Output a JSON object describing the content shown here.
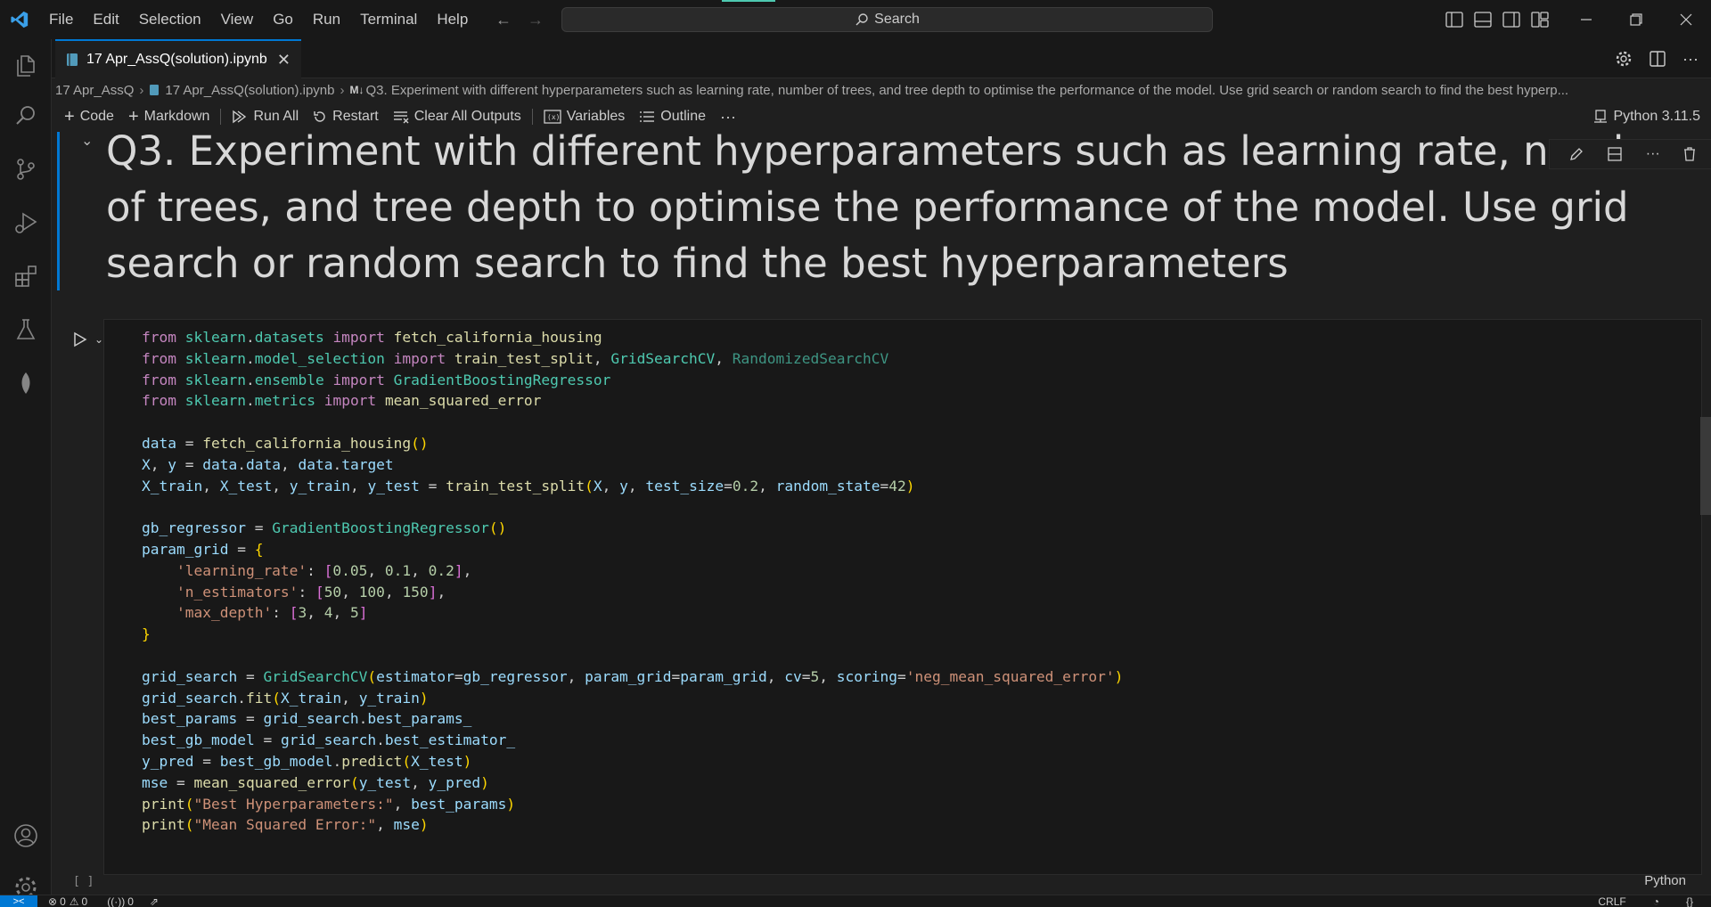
{
  "menu": [
    "File",
    "Edit",
    "Selection",
    "View",
    "Go",
    "Run",
    "Terminal",
    "Help"
  ],
  "search": {
    "label": "Search"
  },
  "tab": {
    "title": "17 Apr_AssQ(solution).ipynb"
  },
  "breadcrumb": {
    "folder": "17 Apr_AssQ",
    "file": "17 Apr_AssQ(solution).ipynb",
    "markdown_badge": "M↓",
    "heading": "Q3. Experiment with different hyperparameters such as learning rate, number of trees, and tree depth to optimise the performance of the model. Use grid search or random search to find the best hyperp..."
  },
  "toolbar": {
    "code": "Code",
    "markdown": "Markdown",
    "run_all": "Run All",
    "restart": "Restart",
    "clear_outputs": "Clear All Outputs",
    "variables": "Variables",
    "outline": "Outline",
    "more": "···",
    "kernel": "Python 3.11.5"
  },
  "markdown_cell": {
    "text": "Q3. Experiment with different hyperparameters such as learning rate, number of trees, and tree depth to optimise the performance of the model. Use grid search or random search to find the best hyperparameters"
  },
  "code_cell": {
    "execution_count": "[ ]",
    "language": "Python"
  },
  "status": {
    "errors": "0",
    "warnings": "0",
    "ports": "0",
    "eol": "CRLF"
  }
}
